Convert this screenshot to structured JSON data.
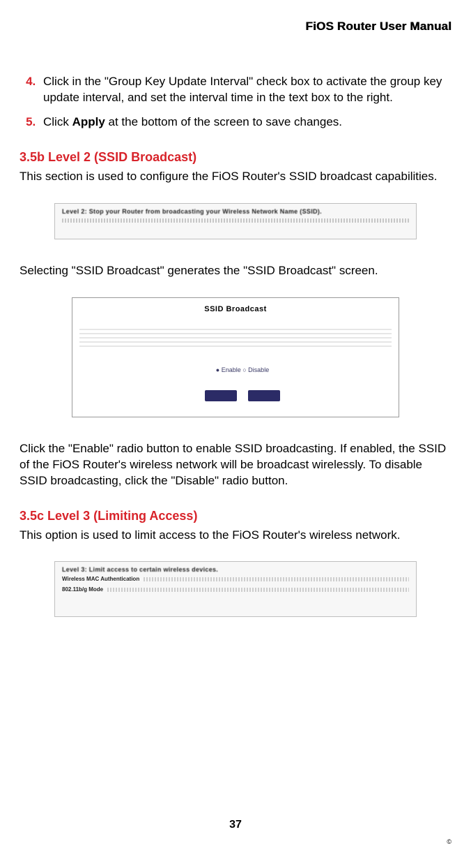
{
  "header": {
    "running_head": "FiOS Router User Manual"
  },
  "steps": {
    "start": 4,
    "items": [
      {
        "n": "4.",
        "text_a": "Click in the \"Group Key Update Interval\" check box to activate the group key update interval, and set the interval time in the text box to the right."
      },
      {
        "n": "5.",
        "text_a": "Click ",
        "bold": "Apply",
        "text_b": " at the bottom of the screen to save changes."
      }
    ]
  },
  "section_b": {
    "heading": "3.5b  Level 2 (SSID Broadcast)",
    "intro": "This section is used to configure the FiOS Router's SSID broadcast capabilities.",
    "caption": " Selecting \"SSID Broadcast\" generates the \"SSID Broadcast\" screen.",
    "para2": "Click the \"Enable\" radio button to enable SSID broadcasting. If enabled, the SSID of the FiOS Router's wireless network will be broadcast wirelessly. To disable SSID broadcasting, click the \"Disable\" radio button."
  },
  "section_c": {
    "heading": "3.5c  Level 3 (Limiting Access)",
    "intro": "This option is used to limit access to the FiOS Router's wireless network."
  },
  "shots": {
    "s1_title": "Level 2: Stop your Router from broadcasting your Wireless Network Name (SSID).",
    "s2_title": "SSID Broadcast",
    "s2_radios": "● Enable   ○ Disable",
    "s3_title": "Level 3: Limit access to certain wireless devices.",
    "s3_r1": "Wireless MAC Authentication",
    "s3_r2": "802.11b/g Mode"
  },
  "footer": {
    "page": "37",
    "copyright": "©"
  }
}
